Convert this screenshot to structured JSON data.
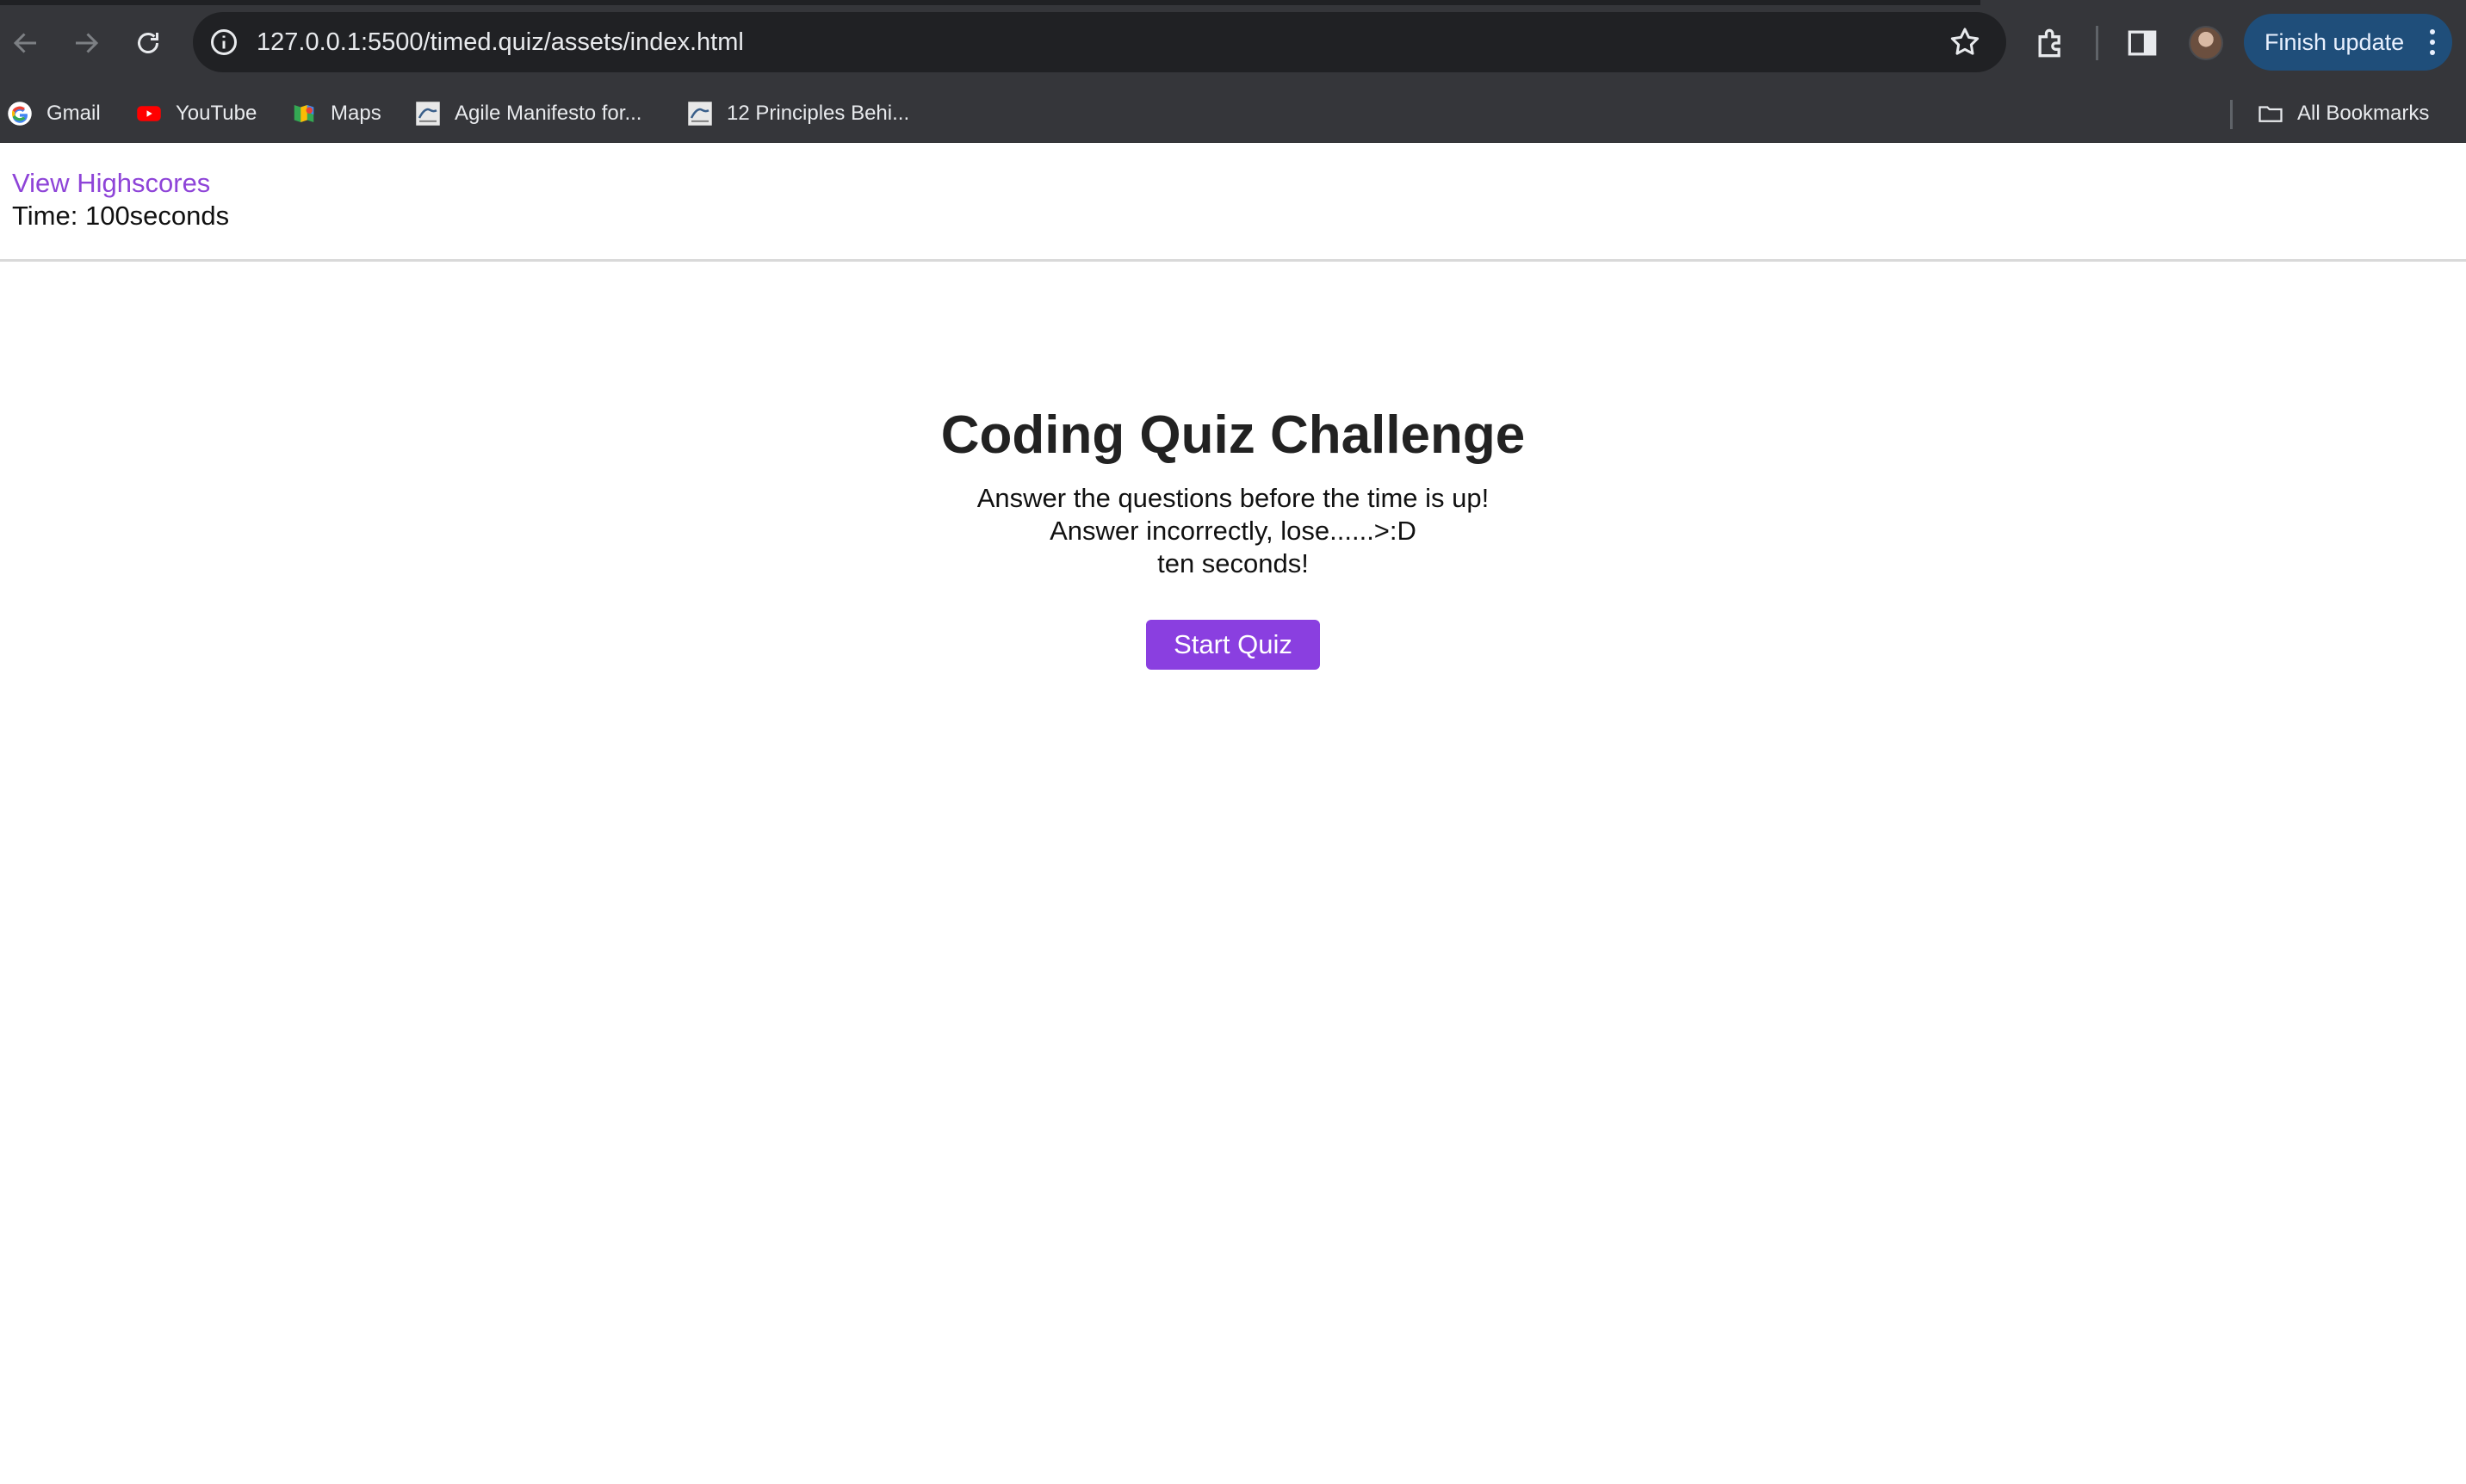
{
  "browser": {
    "url": "127.0.0.1:5500/timed.quiz/assets/index.html",
    "finish_update_label": "Finish update",
    "bookmarks": [
      {
        "label": "Gmail",
        "icon": "google-icon"
      },
      {
        "label": "YouTube",
        "icon": "youtube-icon"
      },
      {
        "label": "Maps",
        "icon": "maps-icon"
      },
      {
        "label": "Agile Manifesto for...",
        "icon": "agile-icon"
      },
      {
        "label": "12 Principles Behi...",
        "icon": "agile-icon"
      }
    ],
    "all_bookmarks_label": "All Bookmarks"
  },
  "header": {
    "highscores_link": "View Highscores",
    "timer": "Time: 100seconds"
  },
  "main": {
    "title": "Coding Quiz Challenge",
    "instructions": [
      "Answer the questions before the time is up!",
      "Answer incorrectly, lose......>:D",
      "ten seconds!"
    ],
    "start_button": "Start Quiz"
  },
  "colors": {
    "accent": "#8a3fe0",
    "link": "#8e44d8",
    "chrome_bg": "#35363a",
    "update_button": "#1f4e7a"
  }
}
